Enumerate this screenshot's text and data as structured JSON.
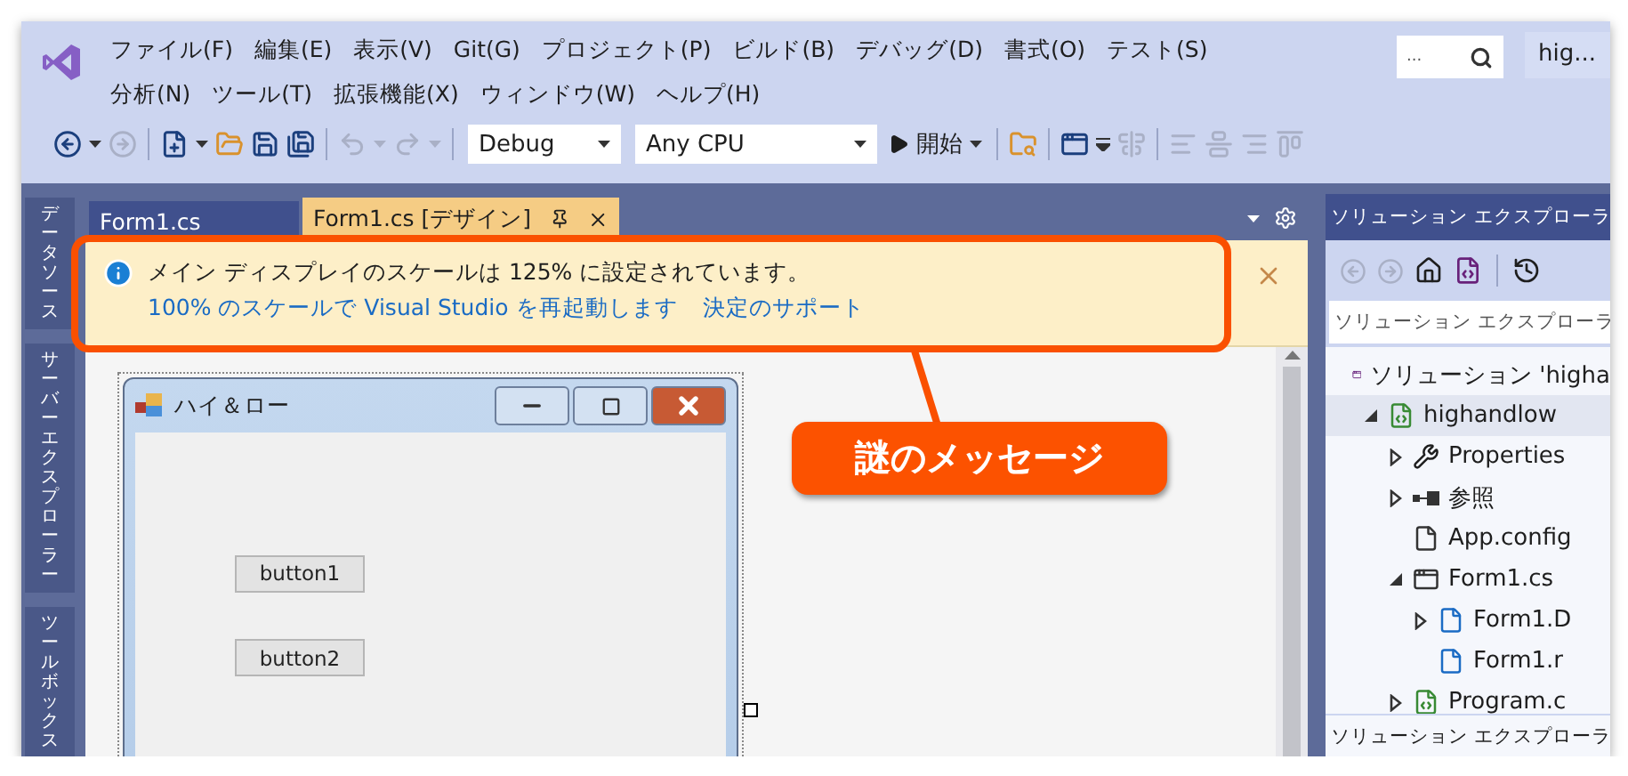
{
  "menu": {
    "rows": [
      [
        "ファイル(F)",
        "編集(E)",
        "表示(V)",
        "Git(G)",
        "プロジェクト(P)",
        "ビルド(B)",
        "デバッグ(D)",
        "書式(O)",
        "テスト(S)"
      ],
      [
        "分析(N)",
        "ツール(T)",
        "拡張機能(X)",
        "ウィンドウ(W)",
        "ヘルプ(H)"
      ]
    ]
  },
  "search": {
    "placeholder": "..."
  },
  "window": {
    "title": "hig..."
  },
  "toolbar": {
    "items": [
      {
        "kind": "back",
        "disabled": false
      },
      {
        "kind": "caret",
        "disabled": false
      },
      {
        "kind": "forward",
        "disabled": true
      },
      {
        "kind": "separator"
      },
      {
        "kind": "new",
        "disabled": false
      },
      {
        "kind": "caret",
        "disabled": false
      },
      {
        "kind": "open",
        "disabled": false
      },
      {
        "kind": "save",
        "disabled": false
      },
      {
        "kind": "save-all",
        "disabled": false
      },
      {
        "kind": "separator"
      },
      {
        "kind": "undo",
        "disabled": true
      },
      {
        "kind": "caret",
        "disabled": true
      },
      {
        "kind": "redo",
        "disabled": true
      },
      {
        "kind": "caret",
        "disabled": true
      },
      {
        "kind": "separator"
      },
      {
        "kind": "config-select",
        "value": "Debug"
      },
      {
        "kind": "platform-select",
        "value": "Any CPU"
      },
      {
        "kind": "start",
        "label": "開始"
      },
      {
        "kind": "separator"
      },
      {
        "kind": "find",
        "disabled": false
      },
      {
        "kind": "separator"
      },
      {
        "kind": "form",
        "disabled": false
      },
      {
        "kind": "overflow"
      },
      {
        "kind": "align-center",
        "disabled": true
      },
      {
        "kind": "separator"
      },
      {
        "kind": "align-left",
        "disabled": true
      },
      {
        "kind": "align-middle",
        "disabled": true
      },
      {
        "kind": "align-right",
        "disabled": true
      },
      {
        "kind": "align-top",
        "disabled": true
      }
    ]
  },
  "side_tabs": [
    "データソース",
    "サーバーエクスプローラー",
    "ツールボックス"
  ],
  "editor_tabs": [
    {
      "label": "Form1.cs",
      "selected": false
    },
    {
      "label": "Form1.cs [デザイン]",
      "selected": true
    }
  ],
  "info_bar": {
    "message": "メイン ディスプレイのスケールは 125% に設定されています。",
    "links": [
      "100% のスケールで Visual Studio を再起動します",
      "決定のサポート"
    ]
  },
  "form": {
    "title": "ハイ＆ロー",
    "buttons": [
      "button1",
      "button2"
    ]
  },
  "solution_explorer": {
    "title": "ソリューション エクスプローラ",
    "search_placeholder": "ソリューション エクスプローラ",
    "bottom_tab": "ソリューション エクスプローラ",
    "tree": [
      {
        "label": "ソリューション 'higha",
        "kind": "solution",
        "selected": false,
        "children": [
          {
            "label": "highandlow",
            "kind": "project",
            "selected": true,
            "expanded": true,
            "children": [
              {
                "label": "Properties",
                "kind": "properties",
                "selected": false,
                "expanded": false
              },
              {
                "label": "参照",
                "kind": "references",
                "selected": false,
                "expanded": false
              },
              {
                "label": "App.config",
                "kind": "config",
                "selected": false
              },
              {
                "label": "Form1.cs",
                "kind": "form",
                "selected": false,
                "expanded": true,
                "children": [
                  {
                    "label": "Form1.D",
                    "kind": "code",
                    "selected": false,
                    "expanded": false
                  },
                  {
                    "label": "Form1.r",
                    "kind": "code",
                    "selected": false
                  }
                ]
              },
              {
                "label": "Program.c",
                "kind": "project",
                "selected": false,
                "expanded": false
              }
            ]
          }
        ]
      }
    ]
  },
  "annotation": {
    "callout": "謎のメッセージ"
  }
}
